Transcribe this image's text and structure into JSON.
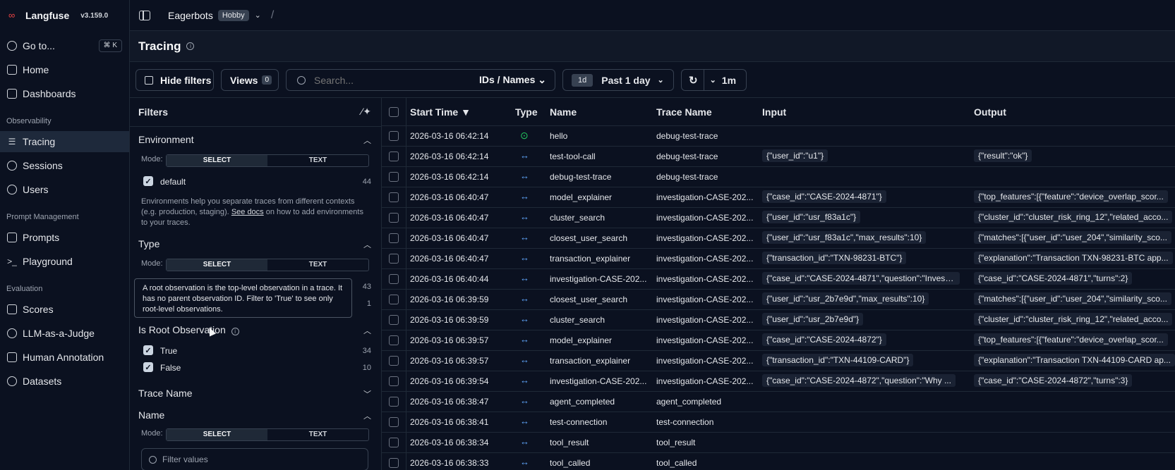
{
  "brand": {
    "name": "Langfuse",
    "version": "v3.159.0"
  },
  "sidebar": {
    "goto": {
      "label": "Go to...",
      "shortcut": "⌘ K"
    },
    "items_top": [
      {
        "label": "Home"
      },
      {
        "label": "Dashboards"
      }
    ],
    "observability_label": "Observability",
    "observability": [
      {
        "label": "Tracing"
      },
      {
        "label": "Sessions"
      },
      {
        "label": "Users"
      }
    ],
    "prompt_label": "Prompt Management",
    "prompt": [
      {
        "label": "Prompts"
      },
      {
        "label": "Playground"
      }
    ],
    "evaluation_label": "Evaluation",
    "evaluation": [
      {
        "label": "Scores"
      },
      {
        "label": "LLM-as-a-Judge"
      },
      {
        "label": "Human Annotation"
      },
      {
        "label": "Datasets"
      }
    ]
  },
  "topbar": {
    "project": "Eagerbots",
    "plan": "Hobby"
  },
  "page": {
    "title": "Tracing"
  },
  "toolbar": {
    "hide_filters": "Hide filters",
    "views": "Views",
    "views_count": "0",
    "search_placeholder": "Search...",
    "search_scope": "IDs / Names",
    "range_tag": "1d",
    "range_label": "Past 1 day",
    "refresh_interval": "1m"
  },
  "filters": {
    "title": "Filters",
    "mode_label": "Mode:",
    "mode_select": "SELECT",
    "mode_text": "TEXT",
    "environment": {
      "title": "Environment",
      "options": [
        {
          "label": "default",
          "count": "44"
        }
      ],
      "help_pre": "Environments help you separate traces from different contexts (e.g. production, staging).",
      "help_link": "See docs",
      "help_post": "on how to add environments to your traces."
    },
    "type": {
      "title": "Type",
      "counts": [
        "43",
        "1"
      ]
    },
    "tooltip": "A root observation is the top-level observation in a trace. It has no parent observation ID. Filter to 'True' to see only root-level observations.",
    "root": {
      "title": "Is Root Observation",
      "options": [
        {
          "label": "True",
          "count": "34"
        },
        {
          "label": "False",
          "count": "10"
        }
      ]
    },
    "trace_name": {
      "title": "Trace Name"
    },
    "name": {
      "title": "Name",
      "placeholder": "Filter values"
    }
  },
  "table": {
    "headers": {
      "start_time": "Start Time ▼",
      "type": "Type",
      "name": "Name",
      "trace_name": "Trace Name",
      "input": "Input",
      "output": "Output"
    },
    "rows": [
      {
        "start": "2026-03-16 06:42:14",
        "type_icon": "⊙",
        "name": "hello",
        "trace": "debug-test-trace",
        "input": "",
        "output": ""
      },
      {
        "start": "2026-03-16 06:42:14",
        "type_icon": "↔",
        "name": "test-tool-call",
        "trace": "debug-test-trace",
        "input": "{\"user_id\":\"u1\"}",
        "output": "{\"result\":\"ok\"}"
      },
      {
        "start": "2026-03-16 06:42:14",
        "type_icon": "↔",
        "name": "debug-test-trace",
        "trace": "debug-test-trace",
        "input": "",
        "output": ""
      },
      {
        "start": "2026-03-16 06:40:47",
        "type_icon": "↔",
        "name": "model_explainer",
        "trace": "investigation-CASE-202...",
        "input": "{\"case_id\":\"CASE-2024-4871\"}",
        "output": "{\"top_features\":[{\"feature\":\"device_overlap_scor..."
      },
      {
        "start": "2026-03-16 06:40:47",
        "type_icon": "↔",
        "name": "cluster_search",
        "trace": "investigation-CASE-202...",
        "input": "{\"user_id\":\"usr_f83a1c\"}",
        "output": "{\"cluster_id\":\"cluster_risk_ring_12\",\"related_acco..."
      },
      {
        "start": "2026-03-16 06:40:47",
        "type_icon": "↔",
        "name": "closest_user_search",
        "trace": "investigation-CASE-202...",
        "input": "{\"user_id\":\"usr_f83a1c\",\"max_results\":10}",
        "output": "{\"matches\":[{\"user_id\":\"user_204\",\"similarity_sco..."
      },
      {
        "start": "2026-03-16 06:40:47",
        "type_icon": "↔",
        "name": "transaction_explainer",
        "trace": "investigation-CASE-202...",
        "input": "{\"transaction_id\":\"TXN-98231-BTC\"}",
        "output": "{\"explanation\":\"Transaction TXN-98231-BTC app..."
      },
      {
        "start": "2026-03-16 06:40:44",
        "type_icon": "↔",
        "name": "investigation-CASE-202...",
        "trace": "investigation-CASE-202...",
        "input": "{\"case_id\":\"CASE-2024-4871\",\"question\":\"Investi...",
        "output": "{\"case_id\":\"CASE-2024-4871\",\"turns\":2}"
      },
      {
        "start": "2026-03-16 06:39:59",
        "type_icon": "↔",
        "name": "closest_user_search",
        "trace": "investigation-CASE-202...",
        "input": "{\"user_id\":\"usr_2b7e9d\",\"max_results\":10}",
        "output": "{\"matches\":[{\"user_id\":\"user_204\",\"similarity_sco..."
      },
      {
        "start": "2026-03-16 06:39:59",
        "type_icon": "↔",
        "name": "cluster_search",
        "trace": "investigation-CASE-202...",
        "input": "{\"user_id\":\"usr_2b7e9d\"}",
        "output": "{\"cluster_id\":\"cluster_risk_ring_12\",\"related_acco..."
      },
      {
        "start": "2026-03-16 06:39:57",
        "type_icon": "↔",
        "name": "model_explainer",
        "trace": "investigation-CASE-202...",
        "input": "{\"case_id\":\"CASE-2024-4872\"}",
        "output": "{\"top_features\":[{\"feature\":\"device_overlap_scor..."
      },
      {
        "start": "2026-03-16 06:39:57",
        "type_icon": "↔",
        "name": "transaction_explainer",
        "trace": "investigation-CASE-202...",
        "input": "{\"transaction_id\":\"TXN-44109-CARD\"}",
        "output": "{\"explanation\":\"Transaction TXN-44109-CARD ap..."
      },
      {
        "start": "2026-03-16 06:39:54",
        "type_icon": "↔",
        "name": "investigation-CASE-202...",
        "trace": "investigation-CASE-202...",
        "input": "{\"case_id\":\"CASE-2024-4872\",\"question\":\"Why ...",
        "output": "{\"case_id\":\"CASE-2024-4872\",\"turns\":3}"
      },
      {
        "start": "2026-03-16 06:38:47",
        "type_icon": "↔",
        "name": "agent_completed",
        "trace": "agent_completed",
        "input": "",
        "output": ""
      },
      {
        "start": "2026-03-16 06:38:41",
        "type_icon": "↔",
        "name": "test-connection",
        "trace": "test-connection",
        "input": "",
        "output": ""
      },
      {
        "start": "2026-03-16 06:38:34",
        "type_icon": "↔",
        "name": "tool_result",
        "trace": "tool_result",
        "input": "",
        "output": ""
      },
      {
        "start": "2026-03-16 06:38:33",
        "type_icon": "↔",
        "name": "tool_called",
        "trace": "tool_called",
        "input": "",
        "output": ""
      }
    ]
  }
}
